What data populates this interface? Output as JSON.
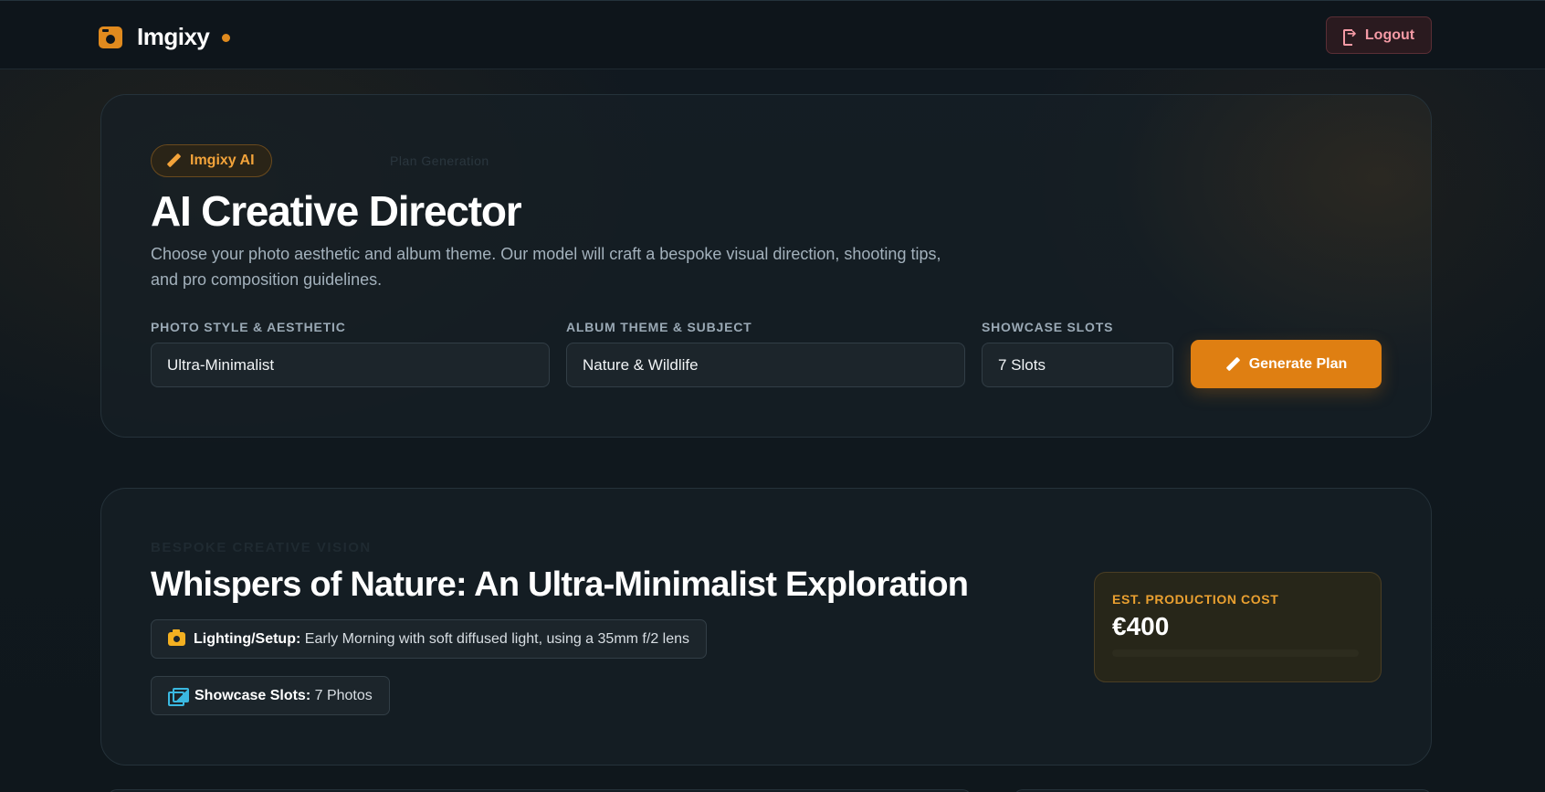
{
  "header": {
    "brand_name": "Imgixy",
    "logout_label": "Logout"
  },
  "hero": {
    "badge_label": "Imgixy AI",
    "badge_subtext": "Plan Generation",
    "title": "AI Creative Director",
    "description": "Choose your photo aesthetic and album theme. Our model will craft a bespoke visual direction, shooting tips, and pro composition guidelines.",
    "fields": {
      "style_label": "PHOTO STYLE & AESTHETIC",
      "style_value": "Ultra-Minimalist",
      "theme_label": "ALBUM THEME & SUBJECT",
      "theme_value": "Nature & Wildlife",
      "slots_label": "SHOWCASE SLOTS",
      "slots_value": "7 Slots"
    },
    "generate_label": "Generate Plan"
  },
  "plan": {
    "kicker": "BESPOKE CREATIVE VISION",
    "title": "Whispers of Nature: An Ultra-Minimalist Exploration",
    "lighting_label": "Lighting/Setup:",
    "lighting_value": "Early Morning with soft diffused light, using a 35mm f/2 lens",
    "slots_label": "Showcase Slots:",
    "slots_value": "7 Photos",
    "cost_label": "EST. PRODUCTION COST",
    "cost_value": "€400"
  },
  "colors": {
    "accent": "#df7f12",
    "background": "#0f161b",
    "danger_text": "#f59aa5",
    "info_icon": "#3ab8e0",
    "camera_icon": "#f3b021"
  },
  "icons": {
    "brand": "camera-box-icon",
    "logout": "logout-icon",
    "badge": "pencil-icon",
    "generate": "pencil-icon",
    "lighting": "camera-icon",
    "slots": "images-icon"
  }
}
